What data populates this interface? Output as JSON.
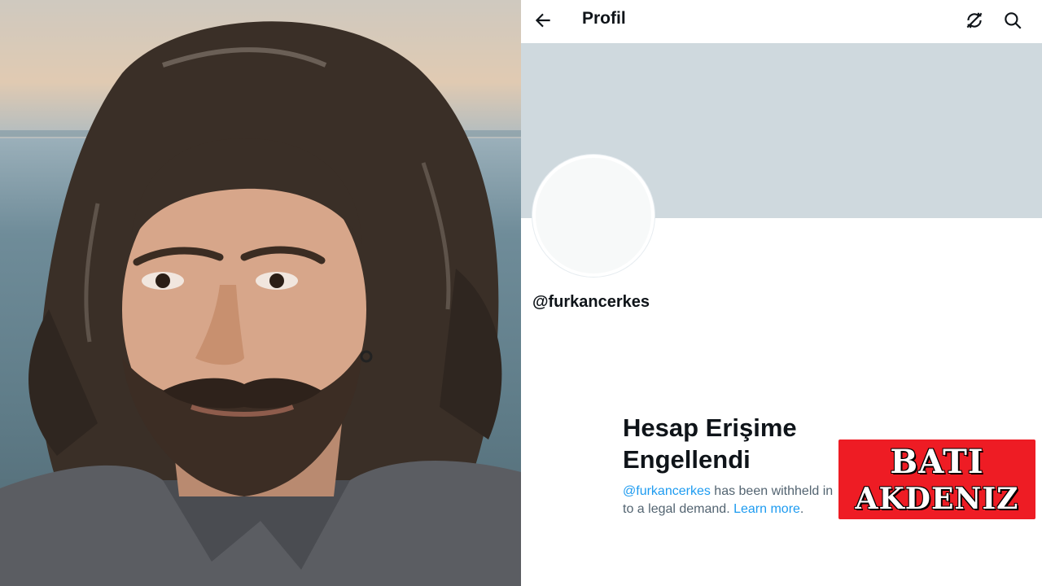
{
  "header": {
    "title": "Profil",
    "back_icon": "arrow-left-icon",
    "sync_icon": "sync-icon",
    "search_icon": "search-icon"
  },
  "profile": {
    "handle": "@furkancerkes"
  },
  "withheld": {
    "title_line1": "Hesap Erişime",
    "title_line2": "Engellendi",
    "mention": "@furkancerkes",
    "text_mid": " has been withheld in",
    "text_line2": "to a legal demand. ",
    "learn_more": "Learn more",
    "period": "."
  },
  "watermark": {
    "line1": "BATI",
    "line2": "AKDENIZ"
  },
  "colors": {
    "accent": "#1d9bf0",
    "banner": "#cfd9de",
    "logo_red": "#ee1c24"
  }
}
